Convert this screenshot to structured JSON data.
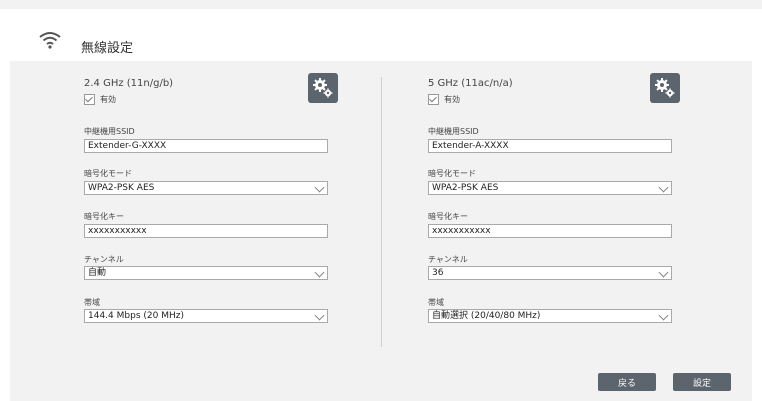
{
  "header": {
    "title": "無線設定",
    "icon": "wifi-icon"
  },
  "bands": [
    {
      "name": "2.4 GHz (11n/g/b)",
      "enabled_label": "有効",
      "enabled": true,
      "ssid_label": "中継機用SSID",
      "ssid": "Extender-G-XXXX",
      "security_label": "暗号化モード",
      "security": "WPA2-PSK AES",
      "key_label": "暗号化キー",
      "key": "xxxxxxxxxxx",
      "channel_label": "チャンネル",
      "channel": "自動",
      "bandwidth_label": "帯域",
      "bandwidth": "144.4 Mbps (20 MHz)"
    },
    {
      "name": "5 GHz (11ac/n/a)",
      "enabled_label": "有効",
      "enabled": true,
      "ssid_label": "中継機用SSID",
      "ssid": "Extender-A-XXXX",
      "security_label": "暗号化モード",
      "security": "WPA2-PSK AES",
      "key_label": "暗号化キー",
      "key": "xxxxxxxxxxx",
      "channel_label": "チャンネル",
      "channel": "36",
      "bandwidth_label": "帯域",
      "bandwidth": "自動選択 (20/40/80 MHz)"
    }
  ],
  "buttons": {
    "back": "戻る",
    "save": "設定"
  },
  "colors": {
    "panel": "#f2f2f2",
    "button": "#5c646d"
  }
}
